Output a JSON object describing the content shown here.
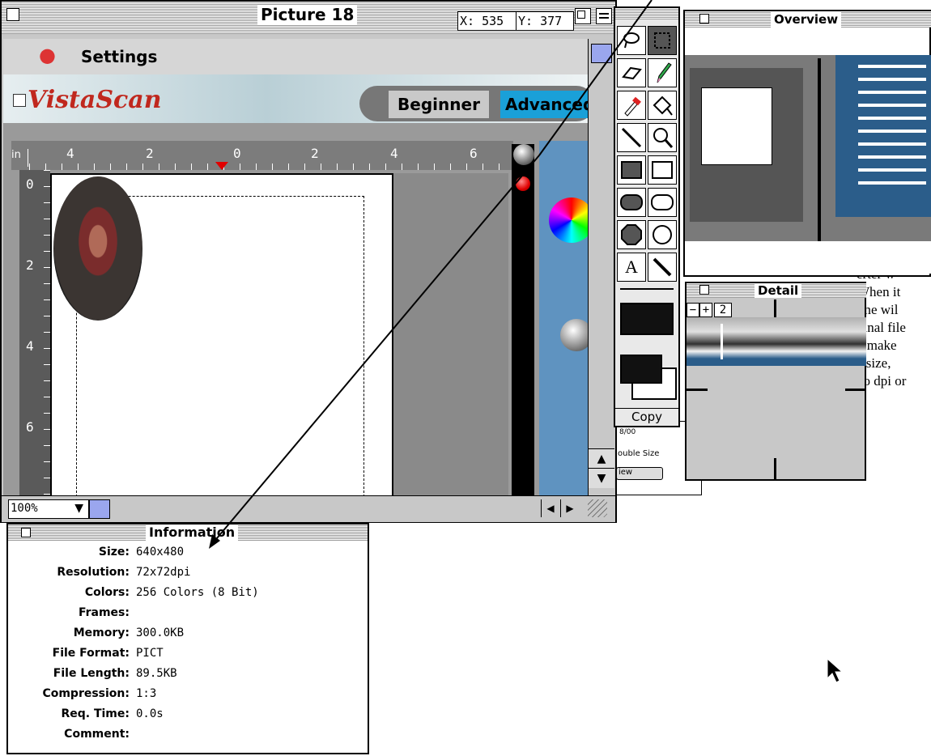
{
  "main_window": {
    "title": "Picture 18",
    "coord_x": "X: 535",
    "coord_y": "Y: 377",
    "zoom": "100%",
    "unit": "in"
  },
  "scanner": {
    "menu_title": "Settings",
    "logo": "VistaScan",
    "mode_beginner": "Beginner",
    "mode_advanced": "Advanced",
    "ruler_h": [
      "4",
      "2",
      "0",
      "2",
      "4",
      "6"
    ],
    "ruler_v": [
      "0",
      "2",
      "4",
      "6"
    ]
  },
  "tools": {
    "items": [
      "lasso-icon",
      "marquee-icon",
      "eraser-icon",
      "pencil-icon",
      "eyedropper-icon",
      "paint-bucket-icon",
      "line-icon",
      "magnifier-icon",
      "filled-rect-icon",
      "rect-icon",
      "filled-rounded-rect-icon",
      "rounded-rect-icon",
      "filled-polygon-icon",
      "polygon-icon",
      "text-icon",
      "brush-icon"
    ],
    "text_tool": "A",
    "copy_label": "Copy"
  },
  "overview": {
    "title": "Overview"
  },
  "detail": {
    "title": "Detail",
    "minus": "−",
    "plus": "+",
    "zoom_level": "2"
  },
  "behind_doc": {
    "lines": [
      "erter w",
      "When it",
      "ime wil",
      "ginal file",
      "d make",
      "e size,",
      "oo dpi or"
    ],
    "button1": "ouble Size",
    "button2": "iew",
    "caption": "8/00"
  },
  "information": {
    "title": "Information",
    "rows": [
      {
        "label": "Size:",
        "value": "640x480"
      },
      {
        "label": "Resolution:",
        "value": "72x72dpi"
      },
      {
        "label": "Colors:",
        "value": "256 Colors (8 Bit)"
      },
      {
        "label": "Frames:",
        "value": ""
      },
      {
        "label": "Memory:",
        "value": "300.0KB"
      },
      {
        "label": "File Format:",
        "value": "PICT"
      },
      {
        "label": "File Length:",
        "value": "89.5KB"
      },
      {
        "label": "Compression:",
        "value": "1:3"
      },
      {
        "label": "Req. Time:",
        "value": "0.0s"
      },
      {
        "label": "Comment:",
        "value": ""
      }
    ]
  }
}
